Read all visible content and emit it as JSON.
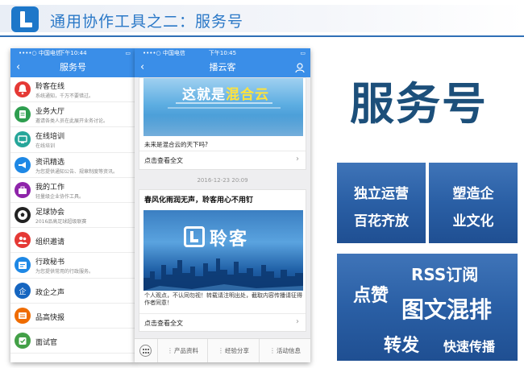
{
  "slide": {
    "title": "通用协作工具之二：服务号",
    "big_title": "服务号"
  },
  "phone1": {
    "status": {
      "carrier": "••••○ 中国电信 ",
      "time": "下午10:44",
      "battery": ""
    },
    "nav_title": "服务号",
    "items": [
      {
        "name": "聆客在线",
        "desc": "系统通知，千万不要错过。",
        "icon": "bell-icon",
        "color": "#e53935"
      },
      {
        "name": "业务大厅",
        "desc": "邀请各类人员在此展开业务讨论。",
        "icon": "document-icon",
        "color": "#2e9e4f"
      },
      {
        "name": "在线培训",
        "desc": "在线培训",
        "icon": "training-icon",
        "color": "#26a69a"
      },
      {
        "name": "资讯精选",
        "desc": "为您提供通知公告、规章制度等资讯。",
        "icon": "megaphone-icon",
        "color": "#1e88e5"
      },
      {
        "name": "我的工作",
        "desc": "轻量级企业协作工具。",
        "icon": "briefcase-icon",
        "color": "#8e24aa"
      },
      {
        "name": "足球协会",
        "desc": "2016品高足球超级联赛",
        "icon": "football-icon",
        "color": "#222222"
      },
      {
        "name": "组织邀请",
        "desc": "",
        "icon": "group-icon",
        "color": "#e53935"
      },
      {
        "name": "行政秘书",
        "desc": "为您提供常用的行政服务。",
        "icon": "secretary-icon",
        "color": "#1e88e5"
      },
      {
        "name": "政企之声",
        "desc": "",
        "icon": "voice-icon",
        "color": "#1565c0"
      },
      {
        "name": "品高快报",
        "desc": "",
        "icon": "news-icon",
        "color": "#ef6c00"
      },
      {
        "name": "面试官",
        "desc": "",
        "icon": "interview-icon",
        "color": "#43a047"
      }
    ]
  },
  "phone2": {
    "status": {
      "carrier": "••••○ 中国电信 ",
      "time": "下午10:45",
      "battery": ""
    },
    "nav_title": "播云客",
    "card1": {
      "banner_pre": "这就是",
      "banner_hl": "混合云",
      "caption": "未来是混合云的天下吗?",
      "view_all": "点击查看全文"
    },
    "date": "2016-12-23 20:09",
    "card2": {
      "headline": "春风化雨润无声，聆客用心不用钉",
      "brand": "聆客",
      "body": "个人观点，不认同勿视！转载请注明出处，截取内容传播请征得作者同意！",
      "view_all": "点击查看全文"
    },
    "menu": [
      "产品资料",
      "经验分享",
      "活动信息"
    ]
  },
  "features": {
    "box_a": [
      "独立运营",
      "百花齐放"
    ],
    "box_b": [
      "塑造企",
      "业文化"
    ],
    "box_c": {
      "rss": "RSS订阅",
      "like": "点赞",
      "mixed": "图文混排",
      "forward": "转发",
      "spread": "快速传播"
    }
  }
}
